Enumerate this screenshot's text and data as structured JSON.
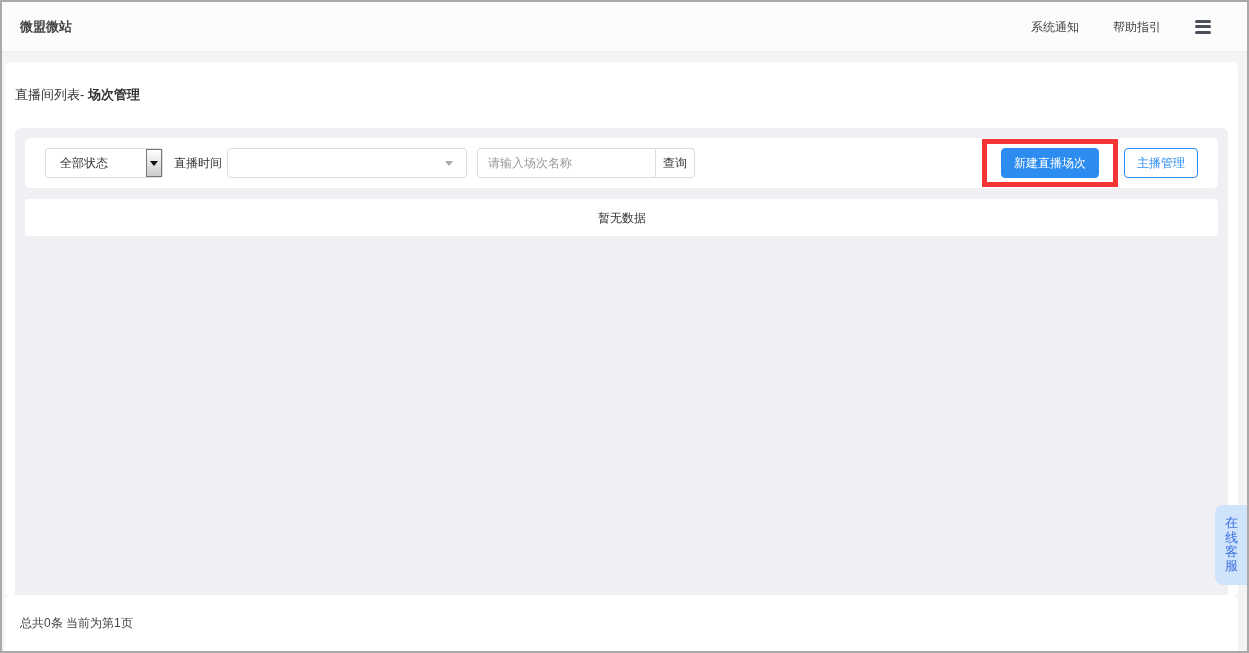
{
  "header": {
    "logo": "微盟微站",
    "links": [
      "系统通知",
      "帮助指引"
    ]
  },
  "page": {
    "breadcrumb": "直播间列表- **场次管理**"
  },
  "filters": {
    "status": "全部状态",
    "time_label": "直播时间",
    "search_placeholder": "请输入场次名称",
    "search_button": "查询"
  },
  "actions": [
    {
      "label": "新建直播场次",
      "kind": "primary",
      "highlighted": true
    },
    {
      "label": "主播管理",
      "kind": "outline",
      "highlighted": false
    }
  ],
  "table": {
    "empty_text": "暂无数据"
  },
  "footer": {
    "summary": "总共0条 当前为第1页"
  },
  "service_tab": "在线客服"
}
